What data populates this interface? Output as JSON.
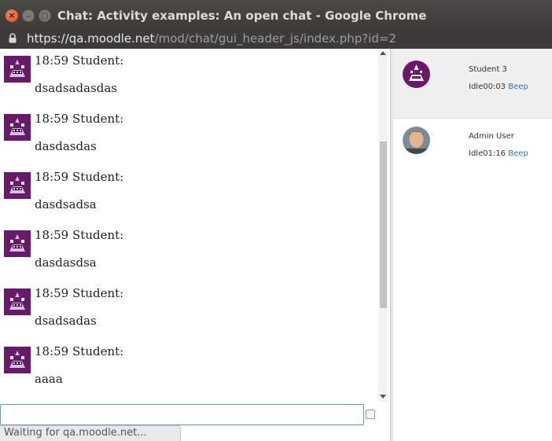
{
  "window": {
    "title": "Chat: Activity examples: An open chat - Google Chrome",
    "close_glyph": "×",
    "min_glyph": "–",
    "max_glyph": "▢"
  },
  "urlbar": {
    "host": "https://qa.moodle.net",
    "path": "/mod/chat/gui_header_js/index.php?id=2",
    "icon": "lock-icon"
  },
  "messages": [
    {
      "time": "18:59",
      "sender": "Student:",
      "text": "dsadsadasdas"
    },
    {
      "time": "18:59",
      "sender": "Student:",
      "text": "dasdasdas"
    },
    {
      "time": "18:59",
      "sender": "Student:",
      "text": "dasdsadsa"
    },
    {
      "time": "18:59",
      "sender": "Student:",
      "text": "dasdasdsa"
    },
    {
      "time": "18:59",
      "sender": "Student:",
      "text": "dsadsadas"
    },
    {
      "time": "18:59",
      "sender": "Student:",
      "text": "aaaa"
    }
  ],
  "input": {
    "value": "",
    "placeholder": ""
  },
  "users": [
    {
      "name": "Student 3",
      "status": "Idle00:03",
      "beep_label": "Beep"
    },
    {
      "name": "Admin User",
      "status": "Idle01:16",
      "beep_label": "Beep"
    }
  ],
  "status_text": "Waiting for qa.moodle.net...",
  "colors": {
    "accent": "#1f76c4",
    "avatar": "#6b176b",
    "titlebar": "#3c3b37"
  }
}
